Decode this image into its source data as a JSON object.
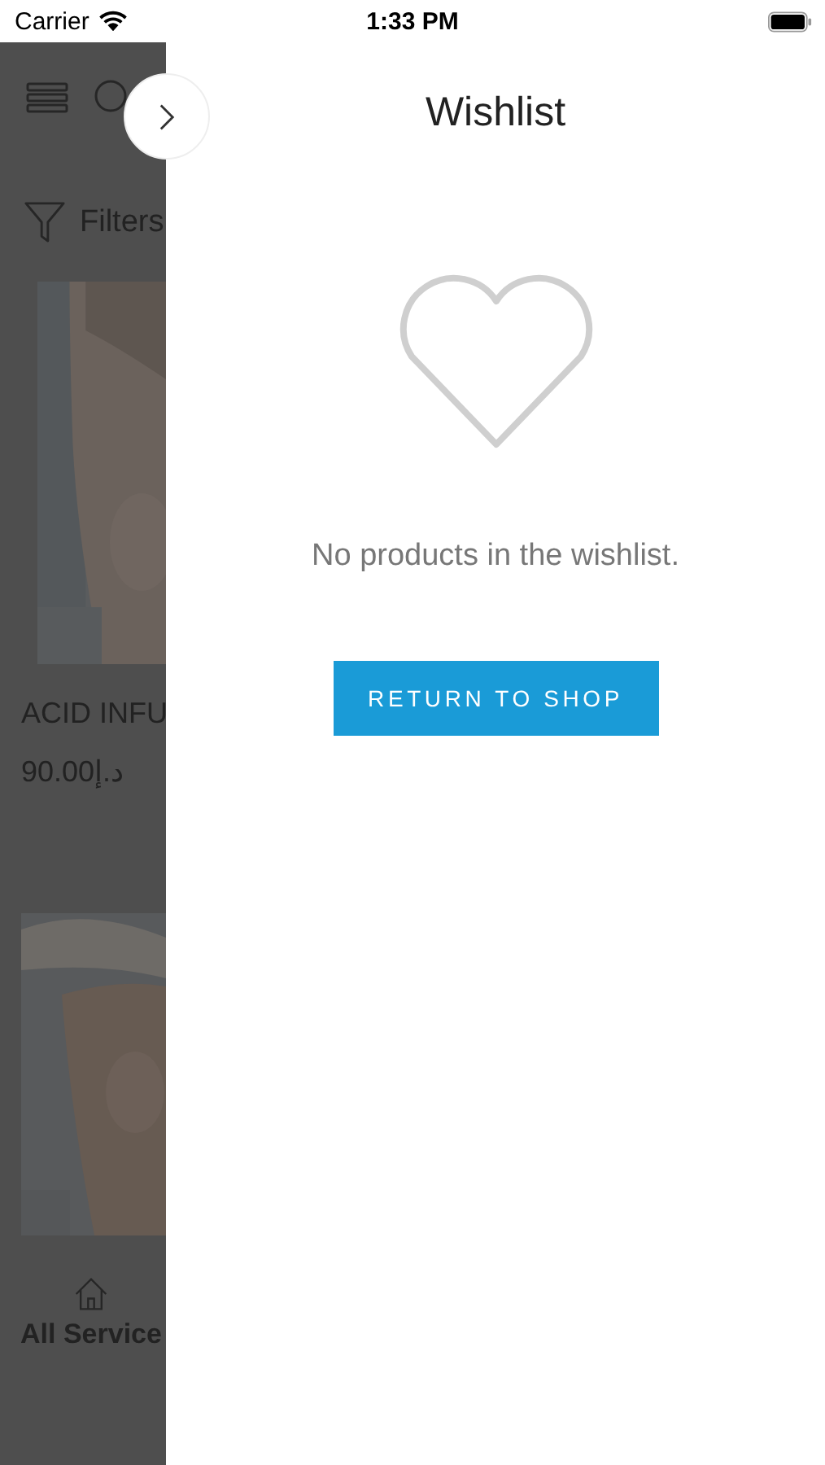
{
  "status_bar": {
    "carrier": "Carrier",
    "time": "1:33 PM"
  },
  "background_page": {
    "filters_label": "Filters",
    "product": {
      "name": "ACID INFU",
      "price": "90.00د.إ"
    },
    "tab_label": "All Service"
  },
  "drawer": {
    "title": "Wishlist",
    "empty_message": "No products in the wishlist.",
    "button": "RETURN TO SHOP"
  }
}
